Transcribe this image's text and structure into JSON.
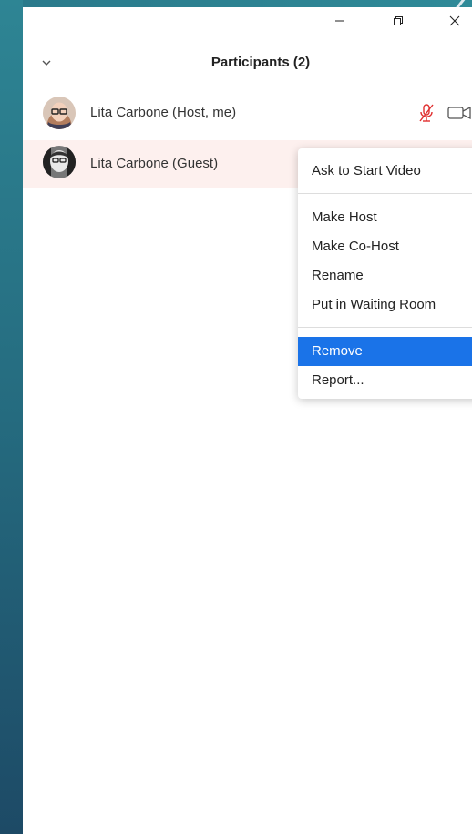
{
  "window": {
    "controls": [
      "minimize",
      "restore",
      "close"
    ]
  },
  "panel": {
    "title": "Participants (2)",
    "collapse_icon": "chevron-down-icon"
  },
  "participants": [
    {
      "name": "Lita Carbone (Host, me)",
      "mic": "muted",
      "video": "off"
    },
    {
      "name": "Lita Carbone (Guest)",
      "highlighted": true
    }
  ],
  "context_menu": {
    "items": [
      {
        "label": "Ask to Start Video"
      },
      {
        "label": "Make Host"
      },
      {
        "label": "Make Co-Host"
      },
      {
        "label": "Rename"
      },
      {
        "label": "Put in Waiting Room"
      },
      {
        "label": "Remove",
        "active": true
      },
      {
        "label": "Report..."
      }
    ]
  },
  "colors": {
    "accent": "#1a73e8",
    "muted_mic": "#e02f2f",
    "row_highlight": "#fdf0ee"
  }
}
